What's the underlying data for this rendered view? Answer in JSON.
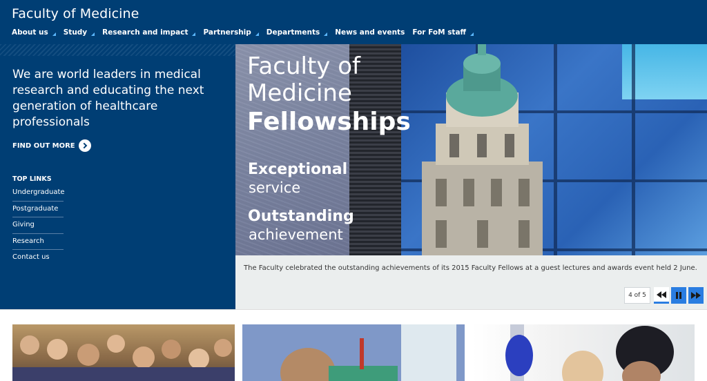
{
  "header": {
    "title": "Faculty of Medicine",
    "nav": [
      {
        "label": "About us",
        "has_submenu": true
      },
      {
        "label": "Study",
        "has_submenu": true
      },
      {
        "label": "Research and impact",
        "has_submenu": true
      },
      {
        "label": "Partnership",
        "has_submenu": true
      },
      {
        "label": "Departments",
        "has_submenu": true
      },
      {
        "label": "News and events",
        "has_submenu": false
      },
      {
        "label": "For FoM staff",
        "has_submenu": true
      }
    ]
  },
  "intro": {
    "lead": "We are world leaders in medical research and educating the next generation of healthcare professionals",
    "find_more": "FIND OUT MORE"
  },
  "top_links": {
    "heading": "TOP LINKS",
    "items": [
      "Undergraduate",
      "Postgraduate",
      "Giving",
      "Research",
      "Contact us"
    ]
  },
  "hero": {
    "title_line1": "Faculty of",
    "title_line2": "Medicine",
    "title_bold": "Fellowships",
    "sub1_bold": "Exceptional",
    "sub1_light": "service",
    "sub2_bold": "Outstanding",
    "sub2_light": "achievement",
    "caption": "The Faculty celebrated the outstanding achievements of its 2015 Faculty Fellows at a guest lectures and awards event held 2 June.",
    "slide_counter": "4 of 5"
  },
  "colors": {
    "brand_blue": "#003e74",
    "accent_blue": "#2a7de1",
    "nav_arrow": "#5cb8ff"
  }
}
